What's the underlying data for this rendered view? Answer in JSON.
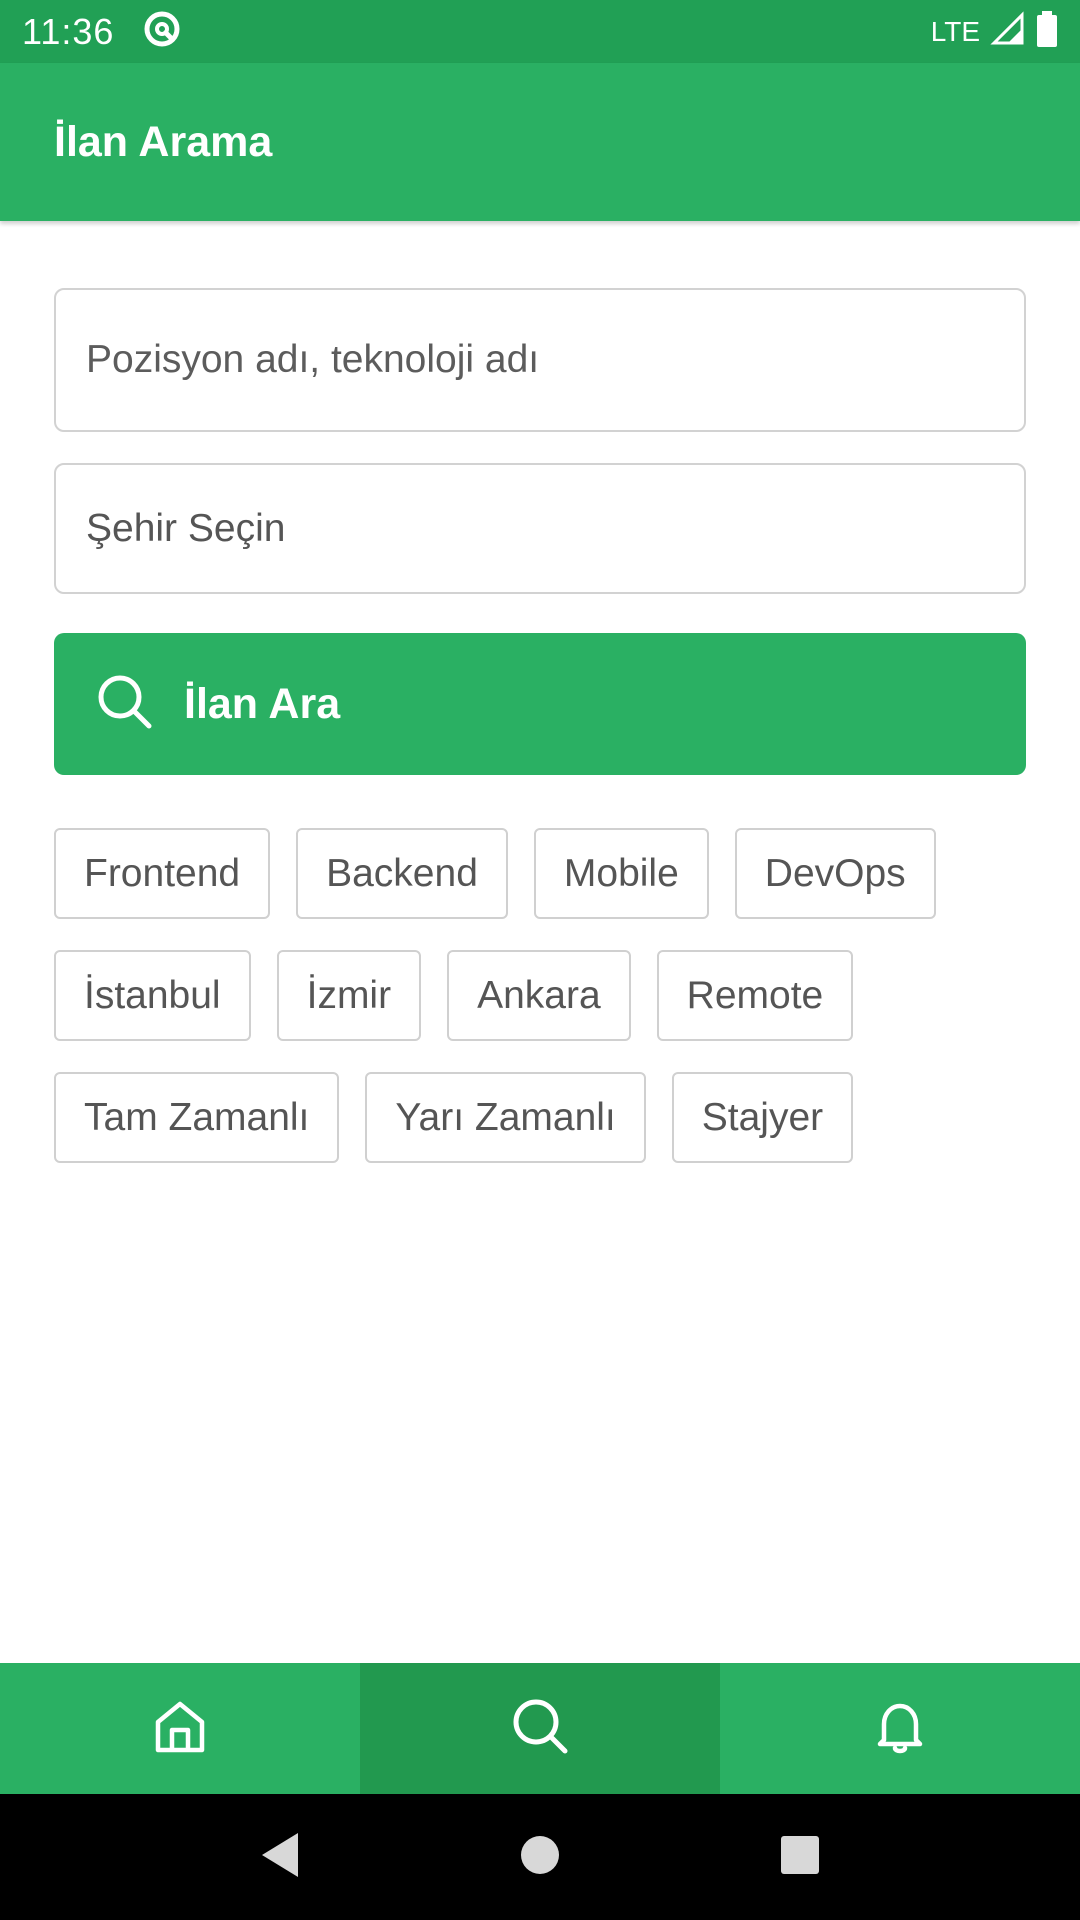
{
  "status_bar": {
    "time": "11:36",
    "network": "LTE"
  },
  "app_bar": {
    "title": "İlan Arama"
  },
  "search": {
    "position_placeholder": "Pozisyon adı, teknoloji adı",
    "city_select": "Şehir Seçin",
    "button_label": "İlan Ara"
  },
  "chips": {
    "row1": [
      "Frontend",
      "Backend",
      "Mobile",
      "DevOps"
    ],
    "row2": [
      "İstanbul",
      "İzmir",
      "Ankara",
      "Remote"
    ],
    "row3": [
      "Tam Zamanlı",
      "Yarı Zamanlı",
      "Stajyer"
    ]
  },
  "bottom_nav": {
    "items": [
      {
        "icon": "home-icon",
        "active": false
      },
      {
        "icon": "search-icon",
        "active": true
      },
      {
        "icon": "bell-icon",
        "active": false
      }
    ]
  },
  "colors": {
    "primary": "#2ab063",
    "primary_dark": "#21a055",
    "nav_active": "#22994f"
  }
}
